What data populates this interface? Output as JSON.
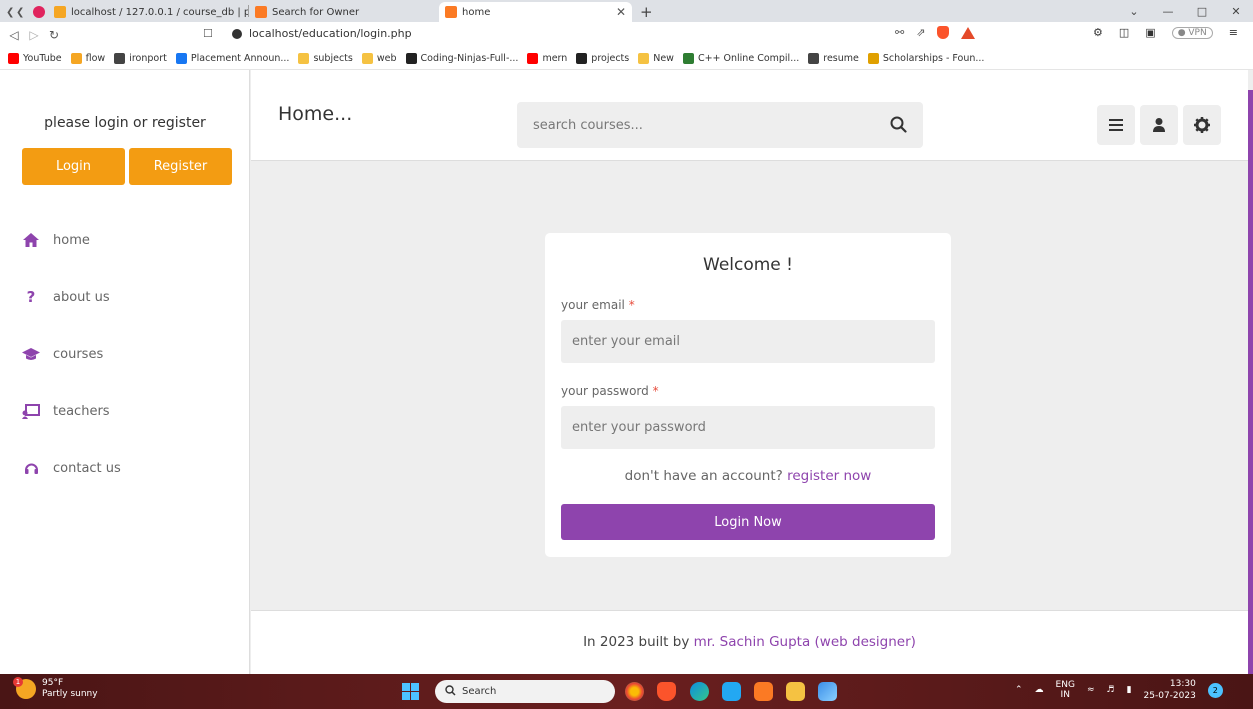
{
  "browser": {
    "tabs": [
      {
        "label": "localhost / 127.0.0.1 / course_db | php",
        "active": false
      },
      {
        "label": "Search for Owner",
        "active": false
      },
      {
        "label": "home",
        "active": true
      }
    ],
    "new_tab": "+",
    "url": "localhost/education/login.php",
    "vpn": "● VPN",
    "bookmarks": [
      {
        "label": "YouTube",
        "color": "#ff0000"
      },
      {
        "label": "flow",
        "color": "#f5a623"
      },
      {
        "label": "ironport",
        "color": "#444444"
      },
      {
        "label": "Placement Announ...",
        "color": "#1877f2"
      },
      {
        "label": "subjects",
        "color": "#f5c242"
      },
      {
        "label": "web",
        "color": "#f5c242"
      },
      {
        "label": "Coding-Ninjas-Full-...",
        "color": "#222222"
      },
      {
        "label": "mern",
        "color": "#ff0000"
      },
      {
        "label": "projects",
        "color": "#222222"
      },
      {
        "label": "New",
        "color": "#f5c242"
      },
      {
        "label": "C++ Online Compil...",
        "color": "#2e7d32"
      },
      {
        "label": "resume",
        "color": "#444444"
      },
      {
        "label": "Scholarships - Foun...",
        "color": "#e0a000"
      }
    ]
  },
  "sidebar": {
    "prompt": "please login or register",
    "login_label": "Login",
    "register_label": "Register",
    "items": [
      {
        "label": "home",
        "icon": "home-icon"
      },
      {
        "label": "about us",
        "icon": "question-icon"
      },
      {
        "label": "courses",
        "icon": "graduation-cap-icon"
      },
      {
        "label": "teachers",
        "icon": "teacher-board-icon"
      },
      {
        "label": "contact us",
        "icon": "headset-icon"
      }
    ]
  },
  "header": {
    "title": "Home...",
    "search_placeholder": "search courses..."
  },
  "login_form": {
    "title": "Welcome !",
    "email_label": "your email",
    "email_placeholder": "enter your email",
    "password_label": "your password",
    "password_placeholder": "enter your password",
    "required_mark": "*",
    "register_prompt": "don't have an account?",
    "register_link": "register now",
    "submit_label": "Login Now"
  },
  "footer": {
    "text": "In 2023 built by",
    "author": "mr. Sachin Gupta (web designer)"
  },
  "taskbar": {
    "weather_temp": "95°F",
    "weather_desc": "Partly sunny",
    "weather_badge": "1",
    "search_label": "Search",
    "lang_top": "ENG",
    "lang_bottom": "IN",
    "time": "13:30",
    "date": "25-07-2023",
    "notif_count": "2"
  },
  "colors": {
    "accent": "#8e44ad",
    "orange": "#f39c12",
    "background": "#eeeeee"
  }
}
